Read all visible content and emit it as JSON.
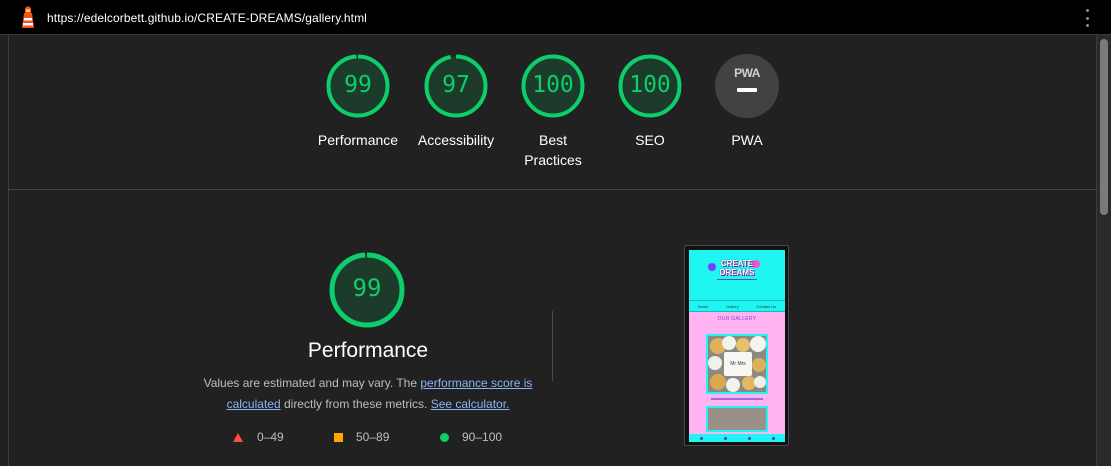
{
  "address_bar": {
    "url": "https://edelcorbett.github.io/CREATE-DREAMS/gallery.html",
    "logo_icon": "lighthouse-icon",
    "menu_icon": "kebab-menu-icon"
  },
  "colors": {
    "pass": "#0cce6b",
    "average": "#ffa400",
    "fail": "#ff4e42",
    "background": "#212121"
  },
  "categories": [
    {
      "id": "performance",
      "label": "Performance",
      "score": "99",
      "score_value": 99
    },
    {
      "id": "accessibility",
      "label": "Accessibility",
      "score": "97",
      "score_value": 97
    },
    {
      "id": "best-practices",
      "label": "Best Practices",
      "score": "100",
      "score_value": 100
    },
    {
      "id": "seo",
      "label": "SEO",
      "score": "100",
      "score_value": 100
    }
  ],
  "pwa": {
    "label": "PWA",
    "badge_text": "PWA"
  },
  "performance_detail": {
    "score": "99",
    "score_value": 99,
    "title": "Performance",
    "desc_pre": "Values are estimated and may vary. The ",
    "link_score": "performance score is calculated",
    "desc_mid": " directly from these metrics. ",
    "link_calc": "See calculator."
  },
  "legend": [
    {
      "range": "0–49",
      "shape": "triangle"
    },
    {
      "range": "50–89",
      "shape": "square"
    },
    {
      "range": "90–100",
      "shape": "circle"
    }
  ],
  "preview": {
    "logo_text": "CREATE DREAMS",
    "nav": [
      "Home",
      "Gallery",
      "Contact Us"
    ],
    "section_title": "OUR GALLERY",
    "photo_text": "Mr Mrs"
  }
}
